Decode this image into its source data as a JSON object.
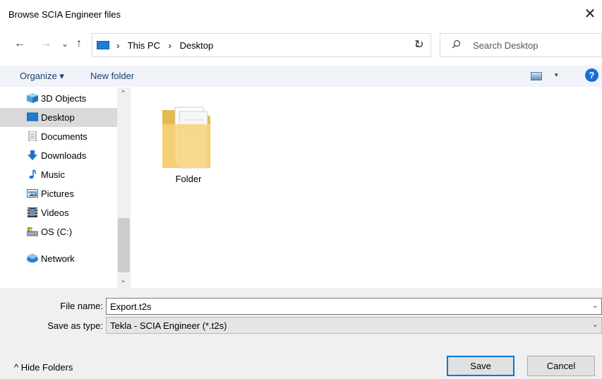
{
  "window": {
    "title": "Browse SCIA Engineer files",
    "close_glyph": "✕"
  },
  "nav": {
    "back": "←",
    "forward": "→",
    "recent": "⌄",
    "up": "↑",
    "refresh": "↻"
  },
  "address": {
    "crumbs": [
      "This PC",
      "Desktop"
    ],
    "separator": "›",
    "dropdown": "⌄"
  },
  "search": {
    "placeholder": "Search Desktop",
    "icon": "search-icon"
  },
  "toolbar": {
    "organize": "Organize ▾",
    "new_folder": "New folder",
    "view_dd": "▾",
    "help": "?"
  },
  "sidebar": {
    "items": [
      {
        "label": "3D Objects",
        "icon": "3d-objects-icon"
      },
      {
        "label": "Desktop",
        "icon": "desktop-icon",
        "selected": true
      },
      {
        "label": "Documents",
        "icon": "documents-icon"
      },
      {
        "label": "Downloads",
        "icon": "downloads-icon"
      },
      {
        "label": "Music",
        "icon": "music-icon"
      },
      {
        "label": "Pictures",
        "icon": "pictures-icon"
      },
      {
        "label": "Videos",
        "icon": "videos-icon"
      },
      {
        "label": "OS (C:)",
        "icon": "drive-icon"
      }
    ],
    "network": {
      "label": "Network",
      "icon": "network-icon"
    },
    "scroll_up": "⌃",
    "scroll_down": "⌄"
  },
  "content": {
    "items": [
      {
        "label": "Folder",
        "icon": "folder-icon"
      }
    ]
  },
  "footer": {
    "file_name_label": "File name:",
    "file_name_value": "Export.t2s",
    "save_type_label": "Save as type:",
    "save_type_value": "Tekla - SCIA Engineer (*.t2s)",
    "chevron": "⌄",
    "hide_folders": "^  Hide Folders",
    "save": "Save",
    "cancel": "Cancel"
  },
  "colors": {
    "accent": "#0078d7",
    "selection": "#d9d9d9",
    "toolbar_bg": "#f0f3f9"
  }
}
